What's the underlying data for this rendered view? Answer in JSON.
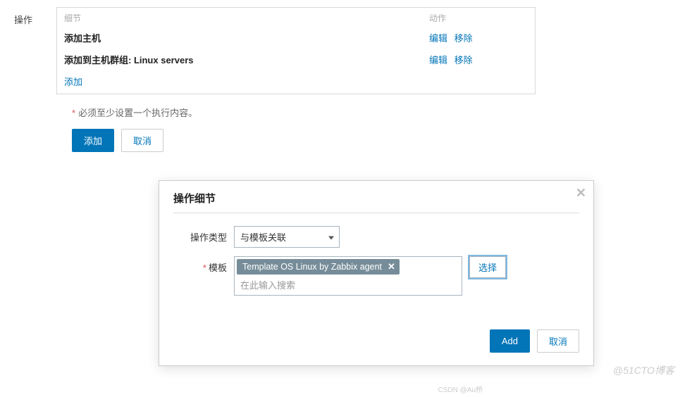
{
  "main": {
    "label": "操作",
    "header_detail": "细节",
    "header_action": "动作",
    "rows": [
      {
        "detail": "添加主机",
        "edit": "编辑",
        "remove": "移除"
      },
      {
        "detail": "添加到主机群组: Linux servers",
        "edit": "编辑",
        "remove": "移除"
      }
    ],
    "add_link": "添加",
    "hint": "必须至少设置一个执行内容。",
    "btn_add": "添加",
    "btn_cancel": "取消"
  },
  "modal": {
    "title": "操作细节",
    "type_label": "操作类型",
    "type_value": "与模板关联",
    "template_label": "模板",
    "template_tag": "Template OS Linux by Zabbix agent",
    "template_placeholder": "在此输入搜索",
    "select_btn": "选择",
    "btn_add": "Add",
    "btn_cancel": "取消"
  },
  "watermark1": "@51CTO博客",
  "watermark2": "CSDN @Au桥"
}
